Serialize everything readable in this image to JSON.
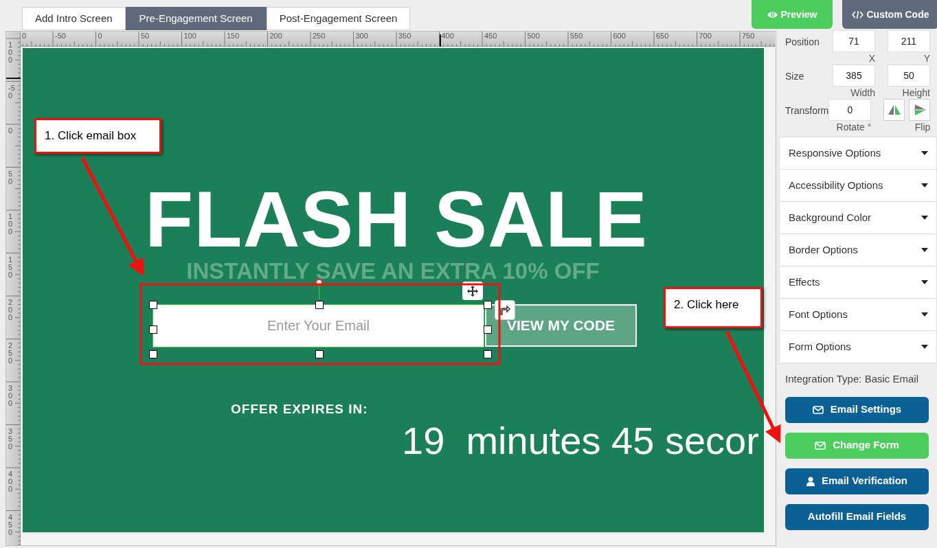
{
  "tabs": [
    {
      "label": "Add Intro Screen",
      "selected": false
    },
    {
      "label": "Pre-Engagement Screen",
      "selected": true
    },
    {
      "label": "Post-Engagement Screen",
      "selected": false
    }
  ],
  "header_buttons": [
    {
      "label": "Preview",
      "kind": "preview"
    },
    {
      "label": "Custom Code",
      "kind": "code"
    }
  ],
  "rulers": {
    "horizontal": [
      "0",
      "-50",
      "0",
      "50",
      "100",
      "150",
      "200",
      "250",
      "300",
      "350",
      "400",
      "450",
      "500",
      "550",
      "600",
      "650",
      "700",
      "750"
    ],
    "vertical": [
      "100",
      "-50",
      "0",
      "50",
      "100",
      "150",
      "200",
      "250",
      "300",
      "350",
      "400",
      "450"
    ]
  },
  "canvas": {
    "headline": "FLASH SALE",
    "subheadline": "INSTANTLY SAVE AN EXTRA 10% OFF",
    "email_placeholder": "Enter Your Email",
    "cta": "VIEW MY CODE",
    "timer_label": "OFFER EXPIRES IN:",
    "timer": "19  minutes 45 secor"
  },
  "annotations": [
    {
      "text": "1. Click email box"
    },
    {
      "text": "2. Click here"
    }
  ],
  "properties": [
    {
      "label": "Position",
      "values": [
        {
          "value": "71",
          "caption": "X"
        },
        {
          "value": "211",
          "caption": "Y"
        }
      ]
    },
    {
      "label": "Size",
      "values": [
        {
          "value": "385",
          "caption": "Width"
        },
        {
          "value": "50",
          "caption": "Height"
        }
      ]
    },
    {
      "label": "Transform",
      "values": [
        {
          "value": "0",
          "caption": "Rotate °"
        }
      ],
      "flip_caption": "Flip"
    }
  ],
  "accordion": [
    {
      "label": "Responsive Options"
    },
    {
      "label": "Accessibility Options"
    },
    {
      "label": "Background Color"
    },
    {
      "label": "Border Options"
    },
    {
      "label": "Effects"
    },
    {
      "label": "Font Options"
    },
    {
      "label": "Form Options"
    }
  ],
  "integration_type": "Integration Type: Basic Email",
  "actions": [
    {
      "label": "Email Settings",
      "kind": "envelope",
      "color": "#0b6196"
    },
    {
      "label": "Change Form",
      "kind": "envelope",
      "color": "#4ccd5e"
    },
    {
      "label": "Email Verification",
      "kind": "user",
      "color": "#0b6196"
    },
    {
      "label": "Autofill Email Fields",
      "kind": "plain",
      "color": "#0b6196"
    }
  ]
}
